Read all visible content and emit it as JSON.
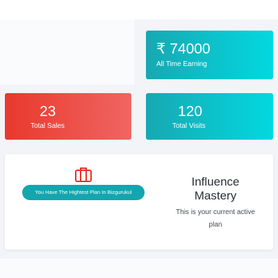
{
  "earnings": {
    "currency": "₹",
    "value": "74000",
    "label": "All Time Earning"
  },
  "sales": {
    "value": "23",
    "label": "Total Sales"
  },
  "visits": {
    "value": "120",
    "label": "Total Visits"
  },
  "plan": {
    "icon": "briefcase-icon",
    "badge_text": "You Have The Hightest Plan In Bizgurukul",
    "title": "Influence Mastery",
    "subtitle": "This is your current active plan"
  },
  "colors": {
    "teal": "#13a6ae",
    "teal_light": "#03d8e0",
    "red": "#e8392c",
    "red_light": "#f06562",
    "icon_red": "#e53027"
  }
}
